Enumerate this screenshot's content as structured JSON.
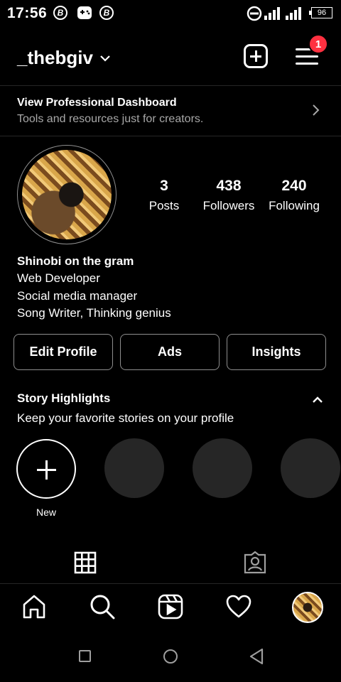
{
  "status_bar": {
    "time": "17:56",
    "notification_icons": [
      "B",
      "game-controller",
      "B"
    ],
    "battery": "96"
  },
  "header": {
    "username": "_thebgiv",
    "notification_count": "1"
  },
  "dashboard": {
    "title": "View Professional Dashboard",
    "subtitle": "Tools and resources just for creators."
  },
  "stats": [
    {
      "value": "3",
      "label": "Posts"
    },
    {
      "value": "438",
      "label": "Followers"
    },
    {
      "value": "240",
      "label": "Following"
    }
  ],
  "bio": {
    "name": "Shinobi on the gram",
    "lines": [
      "Web Developer",
      "Social media manager",
      "Song Writer, Thinking genius"
    ]
  },
  "buttons": {
    "edit_profile": "Edit Profile",
    "ads": "Ads",
    "insights": "Insights"
  },
  "highlights": {
    "title": "Story Highlights",
    "subtitle": "Keep your favorite stories on your profile",
    "new_label": "New"
  },
  "colors": {
    "background": "#000000",
    "badge": "#ff3040",
    "divider": "#262626",
    "muted_text": "#a8a8a8"
  }
}
